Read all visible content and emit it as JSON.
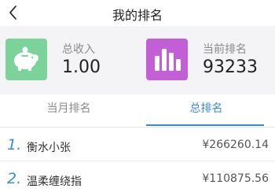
{
  "nav": {
    "back_icon": "chevron-left-icon",
    "title": "我的排名"
  },
  "cards": {
    "total_income": {
      "icon": "piggy-bank-icon",
      "label": "总收入",
      "value": "1.00",
      "color": "#7cd39a"
    },
    "current_rank": {
      "icon": "bar-chart-icon",
      "label": "当前排名",
      "value": "93233",
      "color": "#c25ed6"
    }
  },
  "tabs": [
    {
      "label": "当月排名",
      "active": false
    },
    {
      "label": "总排名",
      "active": true
    }
  ],
  "accent_color": "#3a8bd6",
  "ranking": [
    {
      "rank": "1.",
      "name": "衡水小张",
      "amount": "¥266260.14"
    },
    {
      "rank": "2.",
      "name": "温柔缠绕指",
      "amount": "¥110875.56"
    }
  ]
}
